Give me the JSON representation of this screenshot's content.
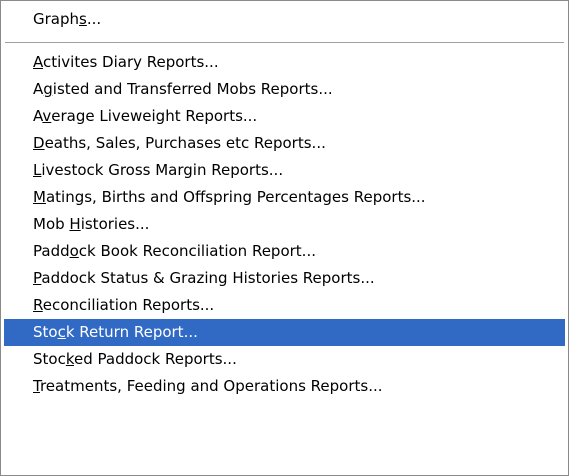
{
  "menu": {
    "top_item": {
      "pre": "Graph",
      "key": "s",
      "post": "..."
    },
    "items": [
      {
        "pre": "",
        "key": "A",
        "post": "ctivites Diary Reports..."
      },
      {
        "pre": "A",
        "key": "g",
        "post": "isted and Transferred Mobs Reports..."
      },
      {
        "pre": "A",
        "key": "v",
        "post": "erage Liveweight Reports..."
      },
      {
        "pre": "",
        "key": "D",
        "post": "eaths, Sales, Purchases etc Reports..."
      },
      {
        "pre": "",
        "key": "L",
        "post": "ivestock Gross Margin Reports..."
      },
      {
        "pre": "",
        "key": "M",
        "post": "atings, Births and Offspring Percentages Reports..."
      },
      {
        "pre": "Mob ",
        "key": "H",
        "post": "istories..."
      },
      {
        "pre": "Padd",
        "key": "o",
        "post": "ck Book Reconciliation Report..."
      },
      {
        "pre": "",
        "key": "P",
        "post": "addock Status & Grazing Histories Reports..."
      },
      {
        "pre": "",
        "key": "R",
        "post": "econciliation Reports..."
      },
      {
        "pre": "Sto",
        "key": "c",
        "post": "k Return Report..."
      },
      {
        "pre": "Stoc",
        "key": "k",
        "post": "ed Paddock Reports..."
      },
      {
        "pre": "",
        "key": "T",
        "post": "reatments, Feeding and Operations Reports..."
      }
    ],
    "selected_label": "Stock Return Report...",
    "highlight_color": "#316ac5"
  }
}
